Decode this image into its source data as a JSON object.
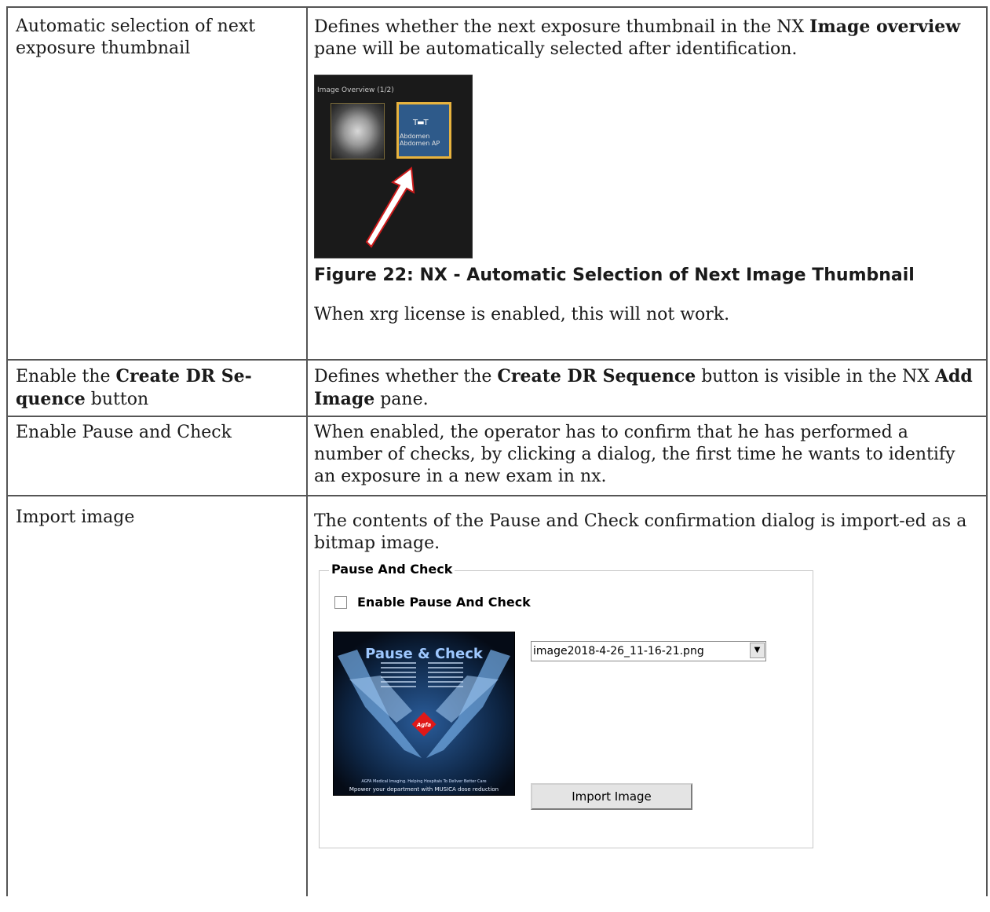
{
  "rows": [
    {
      "setting": "Automatic selection of next exposure thumbnail",
      "desc_pre": "Defines whether the next exposure thumbnail in the NX ",
      "desc_b1": "Image overview",
      "desc_post": " pane will be automatically selected after identification.",
      "figure": {
        "pane_title": "Image Overview (1/2)",
        "thumb_label_1": "Abdomen",
        "thumb_label_2": "Abdomen AP",
        "caption": "Figure 22: NX - Automatic Selection of Next Image Thumbnail"
      },
      "note": "When xrg license is enabled, this will not work."
    },
    {
      "setting_pre": "Enable the ",
      "setting_b": "Create DR Se-quence",
      "setting_post": " button",
      "desc_pre": "Defines whether the ",
      "desc_b1": "Create DR Sequence",
      "desc_mid": " button is visible in the NX ",
      "desc_b2": "Add Image",
      "desc_post": " pane."
    },
    {
      "setting": "Enable Pause and Check",
      "desc": "When enabled, the operator has to confirm that he has performed a number of checks, by clicking a dialog, the first time he wants to identify an exposure in a new exam in nx."
    },
    {
      "setting": "Import image",
      "desc": "The contents of the Pause and Check confirmation dialog is import-ed as a bitmap image.",
      "dialog": {
        "group_title": "Pause And Check",
        "checkbox_label": "Enable Pause And Check",
        "checkbox_checked": false,
        "bitmap_title": "Pause & Check",
        "bitmap_logo": "Agfa",
        "bitmap_footer_1": "AGFA Medical Imaging. Helping Hospitals To Deliver Better Care",
        "bitmap_footer_2": "Mpower your department with MUSICA dose reduction",
        "selected_file": "image2018-4-26_11-16-21.png",
        "import_button": "Import Image"
      }
    }
  ]
}
